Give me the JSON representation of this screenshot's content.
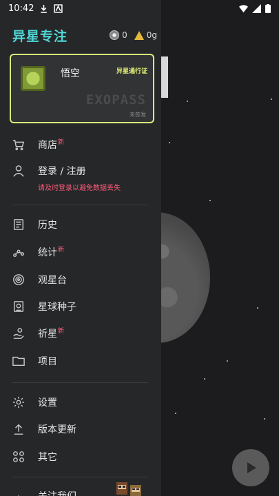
{
  "status_bar": {
    "time": "10:42"
  },
  "header": {
    "title": "异星专注",
    "coin_count": "0",
    "gem_count": "0g"
  },
  "pass_card": {
    "name": "悟空",
    "label": "异星通行证",
    "brand": "EXOPASS",
    "status": "未签发"
  },
  "menu": {
    "shop": {
      "label": "商店",
      "badge": "新"
    },
    "login": {
      "label": "登录 / 注册",
      "hint": "请及时登录以避免数据丢失"
    },
    "history": {
      "label": "历史"
    },
    "stats": {
      "label": "统计",
      "badge": "新"
    },
    "observatory": {
      "label": "观星台"
    },
    "seeds": {
      "label": "星球种子"
    },
    "pray": {
      "label": "祈星",
      "badge": "新"
    },
    "projects": {
      "label": "项目"
    },
    "settings": {
      "label": "设置"
    },
    "update": {
      "label": "版本更新"
    },
    "others": {
      "label": "其它"
    },
    "contact": {
      "label": "关注我们"
    }
  },
  "colors": {
    "accent": "#4fd8d8",
    "card_border": "#d9ee7a",
    "badge": "#ff5a7a",
    "drawer_bg": "#262729"
  }
}
